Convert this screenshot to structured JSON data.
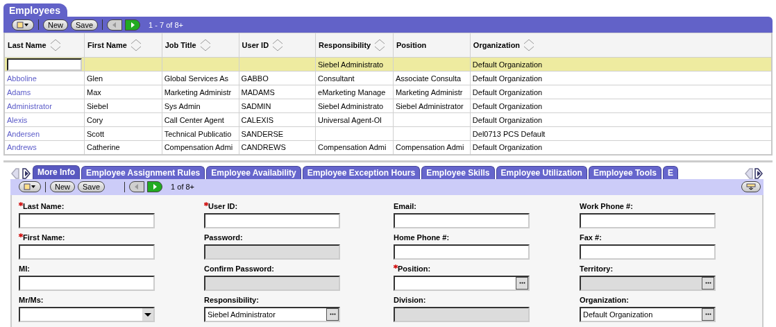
{
  "applet": {
    "title": "Employees",
    "toolbar": {
      "buttons": [
        {
          "label": "New"
        },
        {
          "label": "Save"
        }
      ],
      "prev_disabled": true,
      "next_disabled": false,
      "record_count": "1 - 7 of 8+"
    }
  },
  "table": {
    "columns": [
      {
        "label": "Last Name",
        "sortable": true
      },
      {
        "label": "First Name",
        "sortable": true
      },
      {
        "label": "Job Title",
        "sortable": true
      },
      {
        "label": "User ID",
        "sortable": true
      },
      {
        "label": "Responsibility",
        "sortable": true
      },
      {
        "label": "Position",
        "sortable": false
      },
      {
        "label": "Organization",
        "sortable": true
      }
    ],
    "rows": [
      {
        "selected": true,
        "cells": [
          "",
          "",
          "",
          "",
          "Siebel Administrato",
          "",
          "Default Organization"
        ]
      },
      {
        "selected": false,
        "cells": [
          "Abboline",
          "Glen",
          "Global Services As",
          "GABBO",
          "Consultant",
          "Associate Consulta",
          "Default Organization"
        ]
      },
      {
        "selected": false,
        "cells": [
          "Adams",
          "Max",
          "Marketing Administr",
          "MADAMS",
          "eMarketing Manage",
          "Marketing Administr",
          "Default Organization"
        ]
      },
      {
        "selected": false,
        "cells": [
          "Administrator",
          "Siebel",
          "Sys Admin",
          "SADMIN",
          "Siebel Administrato",
          "Siebel Administrator",
          "Default Organization"
        ]
      },
      {
        "selected": false,
        "cells": [
          "Alexis",
          "Cory",
          "Call Center Agent",
          "CALEXIS",
          "Universal Agent-Ol",
          "",
          "Default Organization"
        ]
      },
      {
        "selected": false,
        "cells": [
          "Andersen",
          "Scott",
          "Technical Publicatio",
          "SANDERSE",
          "",
          "",
          "Del0713 PCS Default"
        ]
      },
      {
        "selected": false,
        "cells": [
          "Andrews",
          "Catherine",
          "Compensation Admi",
          "CANDREWS",
          "Compensation Admi",
          "Compensation Admi",
          "Default Organization"
        ]
      }
    ]
  },
  "detail": {
    "tabs": [
      {
        "label": "More Info",
        "selected": true
      },
      {
        "label": "Employee Assignment Rules",
        "selected": false
      },
      {
        "label": "Employee Availability",
        "selected": false
      },
      {
        "label": "Employee Exception Hours",
        "selected": false
      },
      {
        "label": "Employee Skills",
        "selected": false
      },
      {
        "label": "Employee Utilization",
        "selected": false
      },
      {
        "label": "Employee Tools",
        "selected": false
      },
      {
        "label": "E",
        "selected": false
      }
    ],
    "toolbar": {
      "buttons": [
        {
          "label": "New"
        },
        {
          "label": "Save"
        }
      ],
      "prev_disabled": true,
      "next_disabled": false,
      "record_count": "1 of 8+"
    },
    "form_columns": [
      [
        {
          "label": "Last Name:",
          "required": true,
          "kind": "text"
        },
        {
          "label": "First Name:",
          "required": true,
          "kind": "text"
        },
        {
          "label": "MI:",
          "required": false,
          "kind": "text"
        },
        {
          "label": "Mr/Ms:",
          "required": false,
          "kind": "select"
        }
      ],
      [
        {
          "label": "User ID:",
          "required": true,
          "kind": "text"
        },
        {
          "label": "Password:",
          "required": false,
          "kind": "readonly"
        },
        {
          "label": "Confirm Password:",
          "required": false,
          "kind": "readonly"
        },
        {
          "label": "Responsibility:",
          "required": false,
          "kind": "pick",
          "value": "Siebel Administrator"
        }
      ],
      [
        {
          "label": "Email:",
          "required": false,
          "kind": "text"
        },
        {
          "label": "Home Phone #:",
          "required": false,
          "kind": "text"
        },
        {
          "label": "Position:",
          "required": true,
          "kind": "pick"
        },
        {
          "label": "Division:",
          "required": false,
          "kind": "readonly"
        }
      ],
      [
        {
          "label": "Work Phone #:",
          "required": false,
          "kind": "text"
        },
        {
          "label": "Fax #:",
          "required": false,
          "kind": "text"
        },
        {
          "label": "Territory:",
          "required": false,
          "kind": "readonly-pick"
        },
        {
          "label": "Organization:",
          "required": false,
          "kind": "pick",
          "value": "Default Organization"
        }
      ]
    ]
  }
}
